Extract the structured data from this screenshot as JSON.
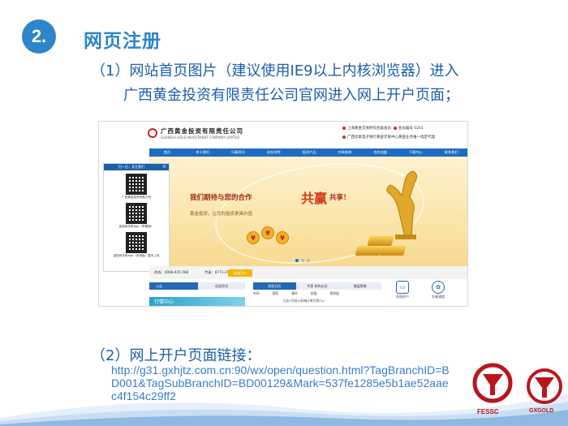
{
  "slide": {
    "number": "2.",
    "title": "网页注册",
    "step1_line1": "（1）网站首页图片（建议使用IE9以上内核浏览器）进入",
    "step1_line2": "广西黄金投资有限责任公司官网进入网上开户页面；",
    "step2_label": "（2）网上开户页面链接：",
    "step2_link": "http://g31.gxhjtz.com.cn:90/wx/open/question.html?TagBranchID=BD001&TagSubBranchID=BD00129&Mark=537fe1285e5b1ae52aaec4f154c29ff2",
    "logos": [
      "FESSC",
      "GXGOLD"
    ]
  },
  "screenshot": {
    "company_cn": "广西黄金投资有限责任公司",
    "company_en": "GUANGXI GOLD INVESTMENT COMPANY LIMITED",
    "info1": "上海黄金交易所综合类会员",
    "info1_b": "会员编号 0261",
    "info2": "广西首家电子银行黄金交易中心黄金业务唯一指定代理",
    "nav": [
      "首页",
      "关于我们",
      "行情资讯",
      "机金学院",
      "投资产品",
      "交易指南",
      "合作加盟",
      "下载中心",
      "联系我们"
    ],
    "qr_title": "扫一扫，关注我们",
    "qr_captions": [
      "广西黄金投资有限公司",
      "金桂树手机app（苹果版）",
      "金桂树手机app（安卓版）暂未上线"
    ],
    "banner_main": "我们期待与您的合作",
    "banner_win": "共赢",
    "banner_end": "共享！",
    "banner_sub": "黄金投资，让您的投资更具价值",
    "hotline": "热线：4008-935-588",
    "hotline2": "传真：0771-2977",
    "button": "在线开户",
    "tab_notice": "公告",
    "tab_news": "动态资讯",
    "market": "行情中心",
    "tabs2": [
      "财经日历",
      "专家·机构论金",
      "操盘策略"
    ],
    "table_head": [
      "时间",
      "国家",
      "事件",
      "前值",
      "预测值"
    ],
    "table_row": "日本7月核心机械订单月率(%)",
    "icon1": "在线开户",
    "icon2": "交易流程",
    "search_placeholder": "金融输入关键"
  }
}
